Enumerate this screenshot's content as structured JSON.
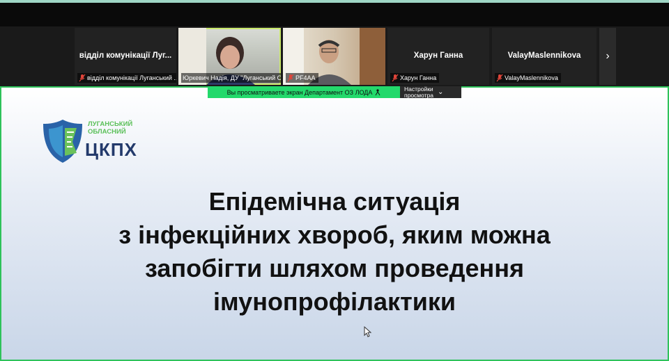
{
  "gallery": {
    "tiles": [
      {
        "big_name": "відділ комунікації Луг...",
        "label": "відділ комунікації Луганський ...",
        "muted": true,
        "video": false
      },
      {
        "big_name": "",
        "label": "Юркевич Надія, ДУ \"Луганський О...",
        "muted": false,
        "video": true,
        "active": true
      },
      {
        "big_name": "",
        "label": "PF4AA",
        "muted": true,
        "video": true
      },
      {
        "big_name": "Харун Ганна",
        "label": "Харун Ганна",
        "muted": true,
        "video": false
      },
      {
        "big_name": "ValayMaslennikova",
        "label": "ValayMaslennikova",
        "muted": true,
        "video": false
      }
    ],
    "next_icon": "›"
  },
  "sharebar": {
    "viewing_text": "Вы просматриваете экран  Департамент ОЗ ЛОДА",
    "settings_line1": "Настройки",
    "settings_line2": "просмотра",
    "settings_icon": "⌄"
  },
  "slide": {
    "logo_line1": "ЛУГАНСЬКИЙ",
    "logo_line2": "ОБЛАСНИЙ",
    "logo_main": "ЦКПХ",
    "title_lines": [
      "Епідемічна ситуація",
      "з інфекційних хвороб, яким можна",
      "запобігти шляхом проведення",
      "імунопрофілактики"
    ]
  },
  "colors": {
    "accent_green": "#23d96b",
    "logo_blue": "#233a6b",
    "logo_green": "#5cc05a",
    "muted_red": "#e0453a"
  }
}
